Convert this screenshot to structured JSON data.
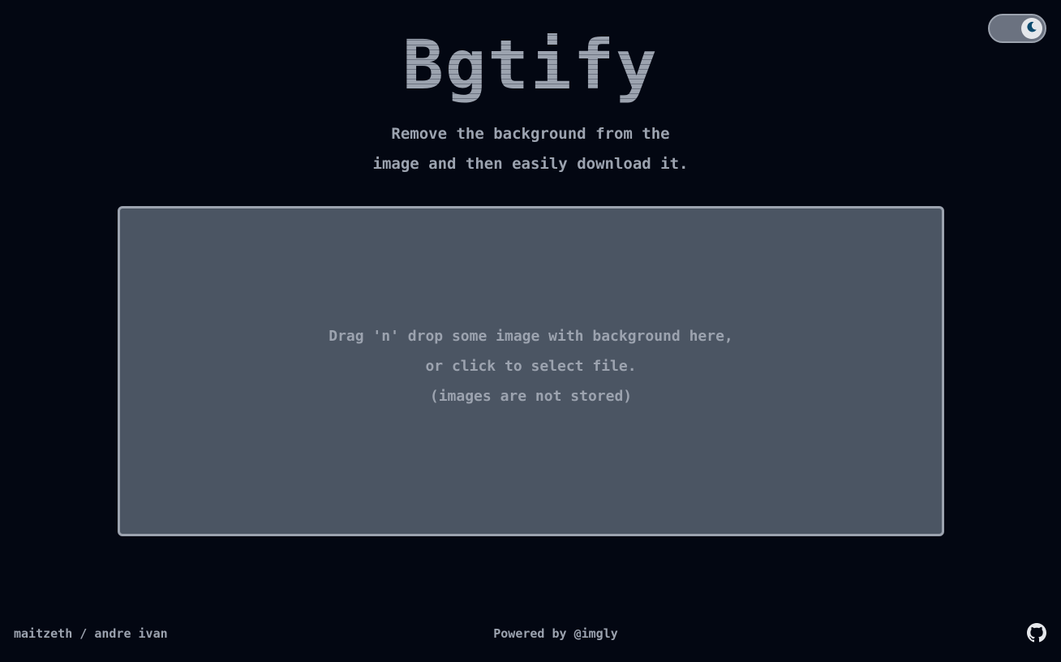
{
  "app": {
    "title": "Bgtify",
    "subtitle_lines": [
      "Remove the background from the",
      "image and then easily download it."
    ]
  },
  "theme_toggle": {
    "mode": "dark",
    "icon": "moon-icon"
  },
  "dropzone": {
    "lines": [
      "Drag 'n' drop some image with background here,",
      "or click to select file.",
      "(images are not stored)"
    ]
  },
  "footer": {
    "authors": "maitzeth / andre ivan",
    "powered_by": "Powered by @imgly",
    "github_icon": "github-icon"
  },
  "colors": {
    "background": "#030712",
    "text": "#9ca3af",
    "dropzone_bg": "#4b5563",
    "dropzone_border": "#9ca3af",
    "toggle_knob_icon": "#0c4a6e"
  }
}
